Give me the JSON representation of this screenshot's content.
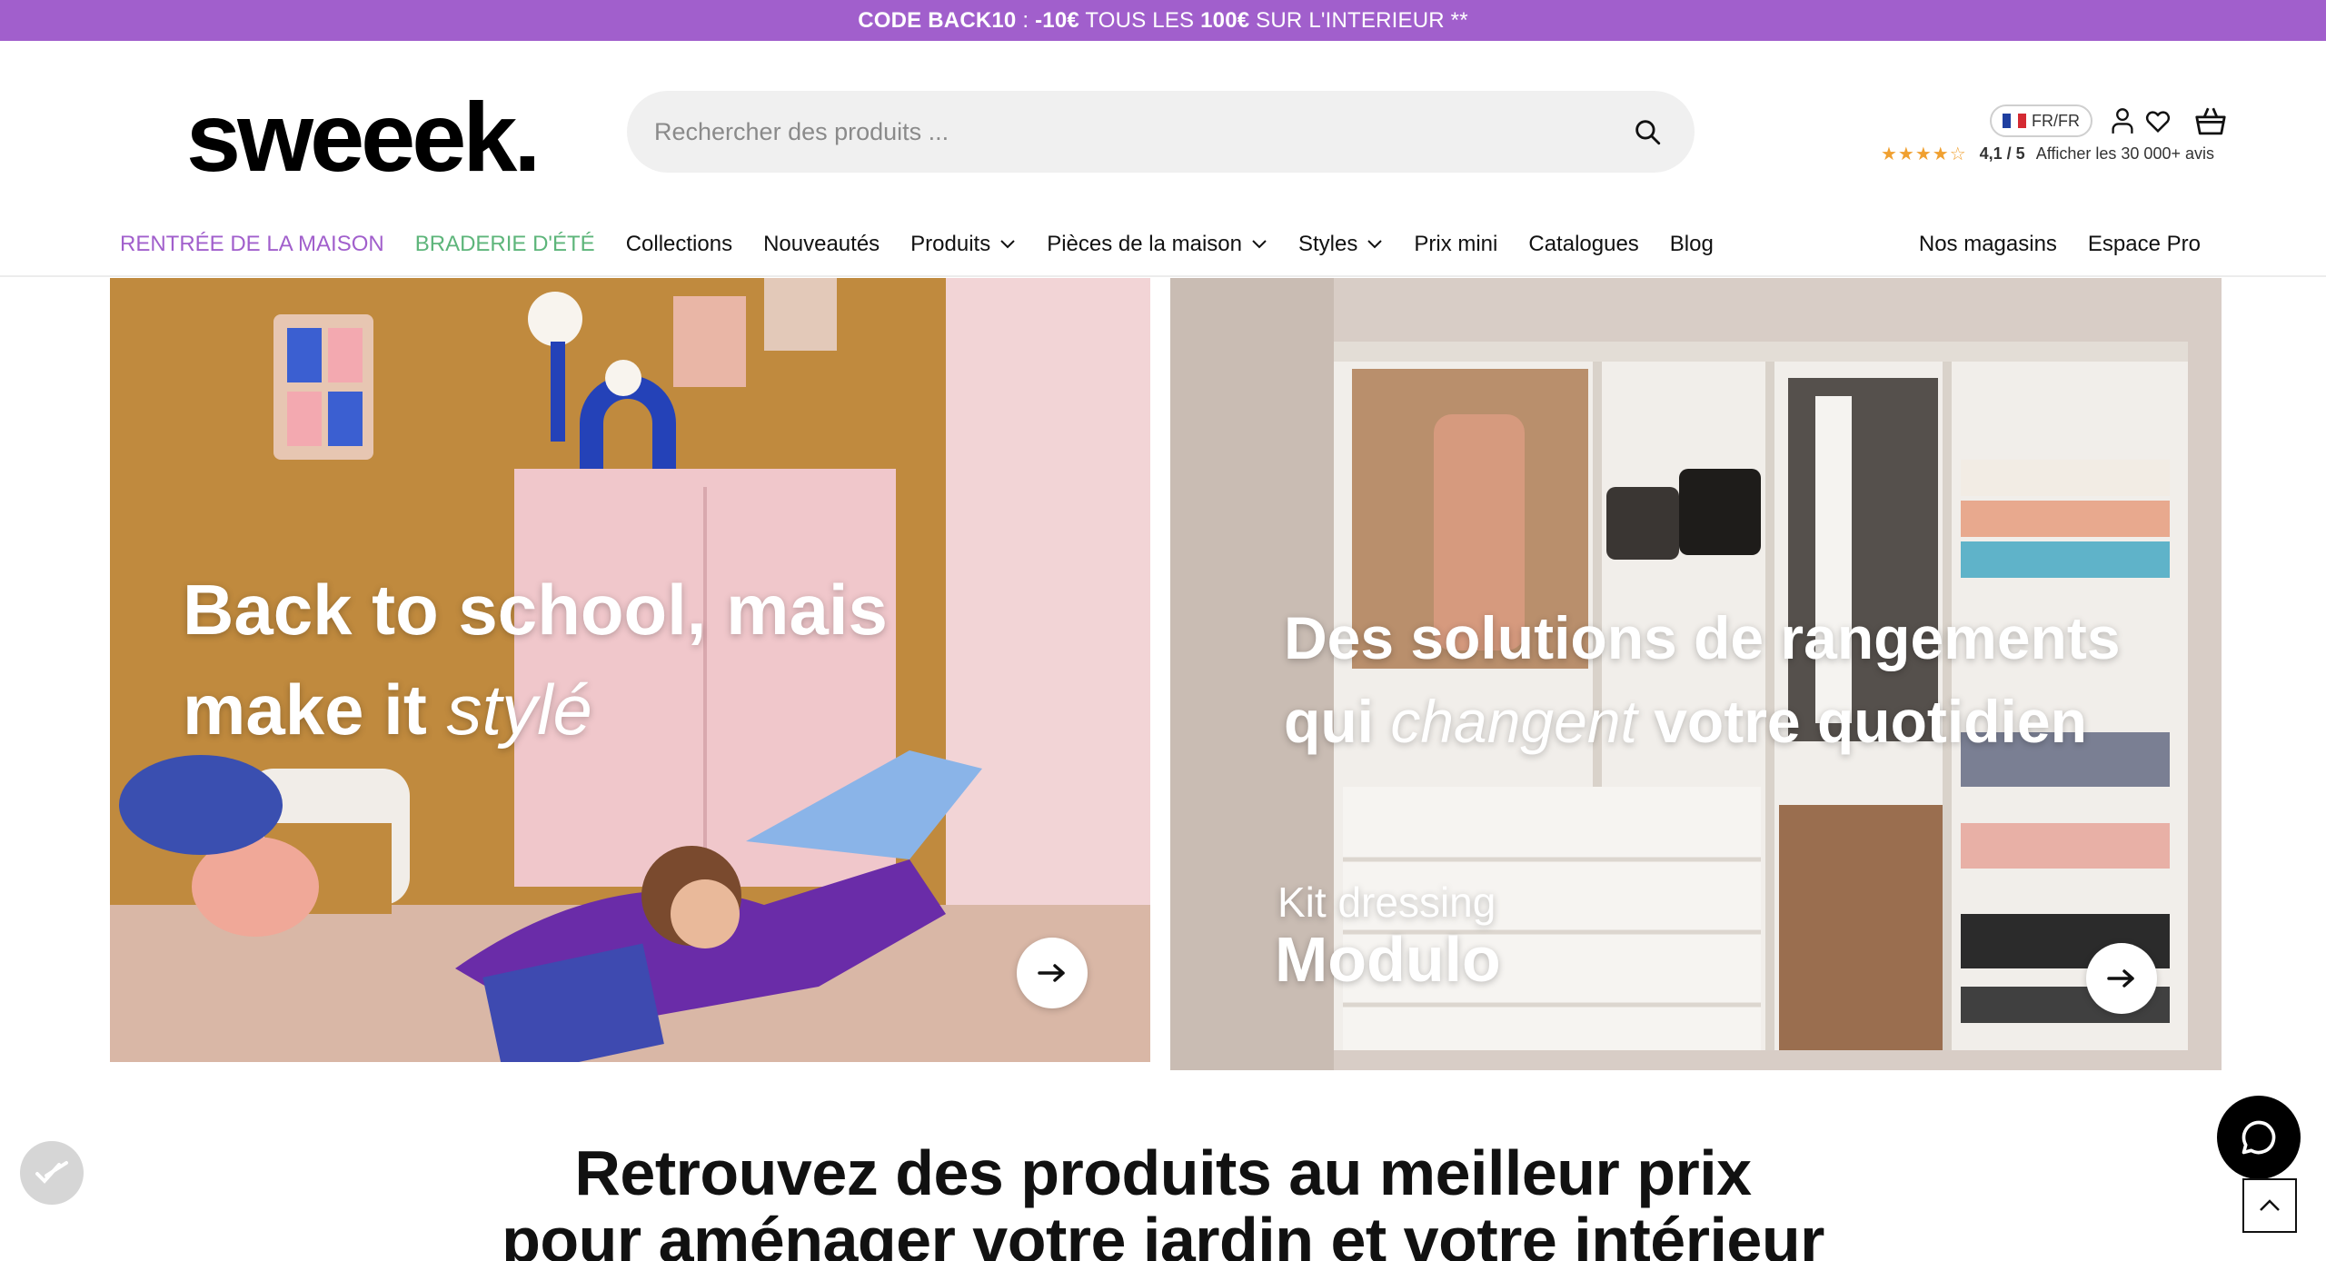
{
  "promo": {
    "code": "CODE BACK10",
    "sep": " : ",
    "discount": "-10€",
    "text1": " TOUS LES ",
    "threshold": "100€",
    "text2": " SUR L'INTERIEUR **"
  },
  "header": {
    "logo": "sweeek.",
    "search_placeholder": "Rechercher des produits ...",
    "lang": "FR/FR",
    "rating_stars": "★★★★☆",
    "rating_value": "4,1 / 5",
    "reviews_link": "Afficher les 30 000+ avis"
  },
  "nav": {
    "items": [
      {
        "label": "RENTRÉE DE LA MAISON"
      },
      {
        "label": "BRADERIE D'ÉTÉ"
      },
      {
        "label": "Collections"
      },
      {
        "label": "Nouveautés"
      },
      {
        "label": "Produits"
      },
      {
        "label": "Pièces de la maison"
      },
      {
        "label": "Styles"
      },
      {
        "label": "Prix mini"
      },
      {
        "label": "Catalogues"
      },
      {
        "label": "Blog"
      }
    ],
    "right": [
      {
        "label": "Nos magasins"
      },
      {
        "label": "Espace Pro"
      }
    ]
  },
  "banners": [
    {
      "line1": "Back to school, mais",
      "line2_a": "make it ",
      "line2_b": "stylé"
    },
    {
      "line1": "Des solutions de rangements",
      "line2_a": "qui ",
      "line2_b": "changent",
      "line2_c": " votre quotidien",
      "kit_label": "Kit dressing",
      "kit_name": "Modulo"
    }
  ],
  "section": {
    "line1": "Retrouvez des produits au meilleur prix",
    "line2": "pour aménager votre jardin et votre intérieur"
  },
  "colors": {
    "promo_bg": "#a15fcc",
    "nav_purple": "#a15fcc",
    "nav_green": "#5db57a",
    "star": "#f0a030"
  }
}
